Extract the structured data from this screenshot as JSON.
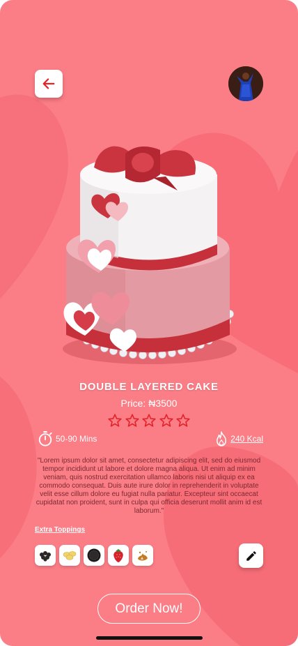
{
  "product": {
    "title": "DOUBLE LAYERED CAKE",
    "price": "Price: ₦3500",
    "rating": 0,
    "rating_max": 5,
    "prep_time": "50-90 Mins",
    "calories": "240 Kcal",
    "description": "\"Lorem ipsum dolor sit amet, consectetur adipiscing elit, sed do eiusmod tempor incididunt ut labore et dolore magna aliqua. Ut enim ad minim veniam, quis nostrud exercitation ullamco laboris nisi ut aliquip ex ea commodo consequat. Duis aute irure dolor in reprehenderit in voluptate velit esse cillum dolore eu fugiat nulla pariatur. Excepteur sint occaecat cupidatat non proident, sunt in culpa qui officia deserunt mollit anim id est laborum.\""
  },
  "toppings": {
    "title": "Extra Toppings",
    "items": [
      "blackberry-icon",
      "banana-chips-icon",
      "cookie-icon",
      "strawberry-icon",
      "caramel-splash-icon"
    ]
  },
  "actions": {
    "order_label": "Order Now!"
  },
  "colors": {
    "background": "#fb7d86",
    "accent": "#e3242b",
    "text_dark": "#7a2a32"
  }
}
